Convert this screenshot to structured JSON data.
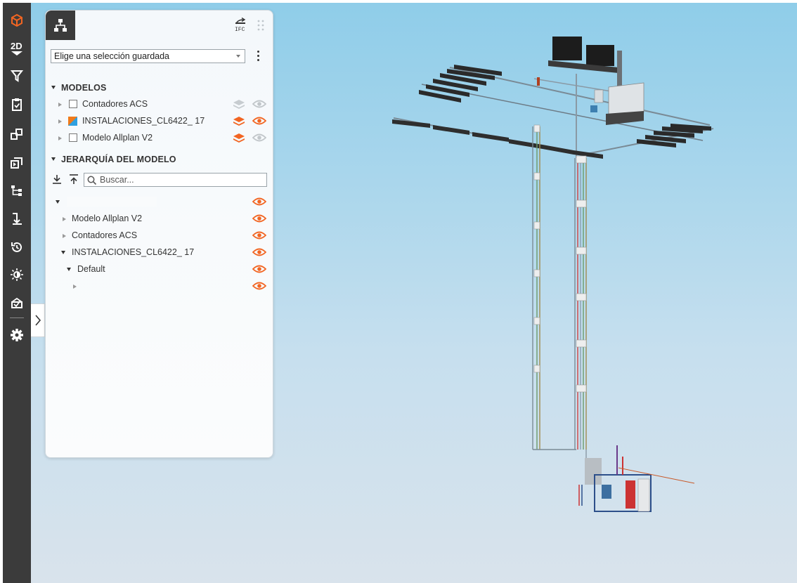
{
  "toolbar": {
    "items": [
      {
        "name": "logo-cube-icon"
      },
      {
        "name": "2d-view-icon",
        "label": "2D"
      },
      {
        "name": "filter-icon"
      },
      {
        "name": "clipboard-check-icon"
      },
      {
        "name": "compare-models-icon"
      },
      {
        "name": "presentation-icon"
      },
      {
        "name": "hierarchy-icon"
      },
      {
        "name": "section-icon"
      },
      {
        "name": "history-icon"
      },
      {
        "name": "lighting-icon"
      },
      {
        "name": "validation-icon"
      },
      {
        "name": "settings-icon"
      }
    ]
  },
  "panel": {
    "ifc_label": "IFC",
    "saved_selection": {
      "value": "Elige una selección guardada",
      "options_button": "more-options"
    },
    "models_section": {
      "title": "MODELOS",
      "items": [
        {
          "label": "Contadores ACS",
          "checked": false,
          "visible": false
        },
        {
          "label": "INSTALACIONES_CL6422_ 17",
          "checked": true,
          "visible": true
        },
        {
          "label": "Modelo Allplan V2",
          "checked": false,
          "visible": false
        }
      ]
    },
    "hierarchy_section": {
      "title": "JERARQUÍA DEL MODELO",
      "search_placeholder": "Buscar...",
      "tree": [
        {
          "label": "",
          "level": 0,
          "expanded": true
        },
        {
          "label": "Modelo Allplan V2",
          "level": 1,
          "expanded": false
        },
        {
          "label": "Contadores ACS",
          "level": 1,
          "expanded": false
        },
        {
          "label": "INSTALACIONES_CL6422_ 17",
          "level": 1,
          "expanded": true
        },
        {
          "label": "Default",
          "level": 2,
          "expanded": true
        },
        {
          "label": "",
          "level": 3,
          "expanded": false
        }
      ]
    }
  },
  "colors": {
    "accent": "#f26522",
    "toolbar_bg": "#3b3b3b",
    "sky_top": "#8fcde9",
    "sky_bottom": "#d9e3ec"
  }
}
